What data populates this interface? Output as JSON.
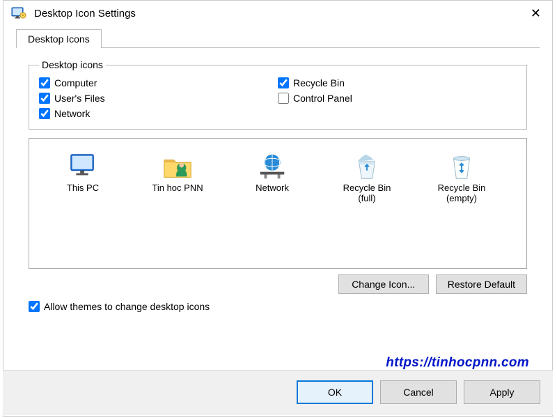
{
  "window": {
    "title": "Desktop Icon Settings"
  },
  "tabs": {
    "main": "Desktop Icons"
  },
  "group": {
    "legend": "Desktop icons"
  },
  "checks": {
    "computer": {
      "label": "Computer",
      "checked": true
    },
    "recycle": {
      "label": "Recycle Bin",
      "checked": true
    },
    "userfiles": {
      "label": "User's Files",
      "checked": true
    },
    "cpanel": {
      "label": "Control Panel",
      "checked": false
    },
    "network": {
      "label": "Network",
      "checked": true
    }
  },
  "icons": {
    "thispc": {
      "label": "This PC"
    },
    "user": {
      "label": "Tin hoc PNN"
    },
    "network": {
      "label": "Network"
    },
    "rbfull": {
      "label1": "Recycle Bin",
      "label2": "(full)"
    },
    "rbempty": {
      "label1": "Recycle Bin",
      "label2": "(empty)"
    }
  },
  "buttons": {
    "changeIcon": "Change Icon...",
    "restoreDefault": "Restore Default",
    "ok": "OK",
    "cancel": "Cancel",
    "apply": "Apply"
  },
  "allowThemes": {
    "label": "Allow themes to change desktop icons",
    "checked": true
  },
  "watermark": "https://tinhocpnn.com"
}
